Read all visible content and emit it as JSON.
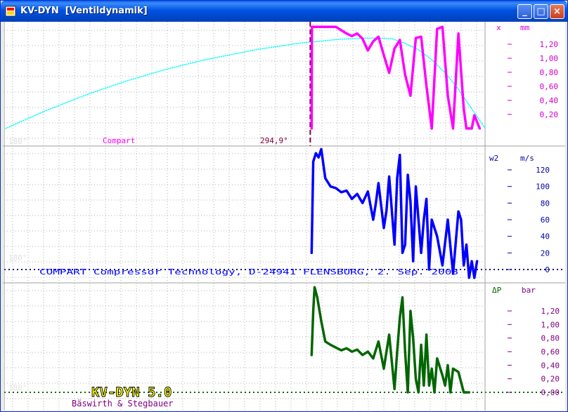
{
  "window": {
    "title": "KV-DYN  [Ventildynamik]",
    "buttons": {
      "minimize": "_",
      "maximize": "□",
      "close": "×"
    }
  },
  "colors": {
    "lift": "#ff00ff",
    "lift_axis": "#cc00cc",
    "ideal_lift": "#00ffff",
    "velocity": "#0000ff",
    "velocity_axis": "#0000aa",
    "pressure": "#006600",
    "pressure_axis": "#800080",
    "grid": "#b0b0b0",
    "marker": "#800040",
    "badge_text": "#ffff00",
    "credit": "#800080"
  },
  "panels": {
    "lift": {
      "var_label": "x",
      "unit_label": "mm",
      "tick_labels": [
        "1,20",
        "1,00",
        "0,80",
        "0,60",
        "0,40",
        "0,20"
      ],
      "deg_label": "180°",
      "left_label": "Compart",
      "angle_label": "294,9°"
    },
    "velocity": {
      "var_label": "w2",
      "unit_label": "m/s",
      "tick_labels": [
        "120",
        "100",
        "80",
        "60",
        "40",
        "20",
        "0"
      ],
      "deg_label": "180°",
      "caption": "COMPART Compressor Technology, D-24941 FLENSBURG, 2. Sep. 2008"
    },
    "pressure": {
      "var_label": "ΔP",
      "unit_label": "bar",
      "tick_labels": [
        "1,20",
        "1,00",
        "0,80",
        "0,60",
        "0,40",
        "0,20",
        "0,00"
      ],
      "deg_label": "180°",
      "badge": "KV-DYN 5.0",
      "credit": "Bäswirth & Stegbauer"
    }
  },
  "chart_data": [
    {
      "type": "line",
      "title": "",
      "xlabel": "",
      "ylabel": "x mm",
      "xlim": [
        180,
        360
      ],
      "ylim": [
        0,
        1.6
      ],
      "series": [
        {
          "x": [
            180,
            185,
            190,
            195,
            200,
            205,
            210,
            215,
            220,
            225,
            230,
            235,
            240,
            245,
            250,
            255,
            260,
            265,
            270,
            275,
            280,
            285,
            290,
            295,
            300,
            305,
            310,
            315,
            320,
            325,
            330,
            335,
            340,
            345,
            350,
            355,
            360
          ],
          "y": [
            0.0,
            0.09,
            0.18,
            0.27,
            0.35,
            0.43,
            0.51,
            0.58,
            0.65,
            0.72,
            0.78,
            0.84,
            0.9,
            0.95,
            1.0,
            1.05,
            1.09,
            1.13,
            1.17,
            1.21,
            1.24,
            1.27,
            1.3,
            1.32,
            1.34,
            1.36,
            1.37,
            1.38,
            1.38,
            1.37,
            1.3,
            1.2,
            1.05,
            0.85,
            0.6,
            0.3,
            0.0
          ]
        },
        {
          "x": [
            294.9,
            295,
            296,
            298,
            300,
            304,
            306,
            308,
            310,
            312,
            314,
            316,
            318,
            320,
            322,
            324,
            326,
            328,
            330,
            332,
            334,
            336,
            338,
            340,
            342,
            344,
            346,
            348,
            350,
            352,
            353,
            355,
            356,
            358
          ],
          "y": [
            0.0,
            1.55,
            1.55,
            1.55,
            1.55,
            1.55,
            1.5,
            1.45,
            1.41,
            1.45,
            1.37,
            1.19,
            1.33,
            1.4,
            1.12,
            0.85,
            1.22,
            1.35,
            0.82,
            0.5,
            1.38,
            1.4,
            0.65,
            0.0,
            1.52,
            1.55,
            0.5,
            0.0,
            1.45,
            0.3,
            0.0,
            0.0,
            0.2,
            0.0
          ]
        }
      ]
    },
    {
      "type": "line",
      "title": "",
      "xlabel": "",
      "ylabel": "w2 m/s",
      "xlim": [
        180,
        360
      ],
      "ylim": [
        -10,
        140
      ],
      "series": [
        {
          "x": [
            294.9,
            295.5,
            296.5,
            297.5,
            298.5,
            300,
            302,
            304,
            306,
            308,
            310,
            312,
            314,
            316,
            318,
            319,
            320,
            322,
            323,
            324,
            326,
            327,
            328,
            329,
            330,
            331,
            332,
            333,
            334,
            336,
            337,
            338,
            339,
            340,
            342,
            344,
            346,
            348,
            350,
            351,
            352,
            353,
            354,
            355,
            356,
            357
          ],
          "y": [
            20,
            130,
            140,
            135,
            145,
            110,
            100,
            98,
            93,
            95,
            85,
            91,
            80,
            94,
            60,
            80,
            104,
            50,
            71,
            112,
            30,
            110,
            138,
            20,
            30,
            114,
            82,
            10,
            100,
            20,
            60,
            85,
            0,
            60,
            40,
            5,
            60,
            -5,
            70,
            60,
            5,
            30,
            -10,
            10,
            -10,
            10
          ]
        }
      ]
    },
    {
      "type": "line",
      "title": "",
      "xlabel": "",
      "ylabel": "ΔP bar",
      "xlim": [
        180,
        360
      ],
      "ylim": [
        0,
        1.6
      ],
      "series": [
        {
          "x": [
            294.9,
            295.5,
            296,
            297,
            298.5,
            300,
            302,
            306,
            308,
            310,
            312,
            314,
            316,
            318,
            320,
            322,
            324,
            326,
            327,
            328,
            329,
            330,
            331,
            332,
            333,
            334,
            335,
            336,
            337,
            338,
            339,
            340,
            341,
            342,
            344,
            345,
            346,
            347,
            348,
            350,
            352,
            354
          ],
          "y": [
            0.55,
            1.2,
            1.55,
            1.4,
            1.05,
            0.75,
            0.7,
            0.62,
            0.65,
            0.6,
            0.63,
            0.55,
            0.6,
            0.5,
            0.75,
            0.35,
            0.85,
            0.05,
            0.6,
            1.1,
            1.4,
            0.6,
            0.0,
            1.2,
            0.8,
            0.2,
            0.0,
            0.7,
            0.1,
            0.85,
            0.1,
            0.35,
            0.0,
            0.5,
            0.25,
            0.1,
            0.4,
            0.0,
            0.35,
            0.3,
            0.0,
            0.0
          ]
        }
      ]
    }
  ]
}
